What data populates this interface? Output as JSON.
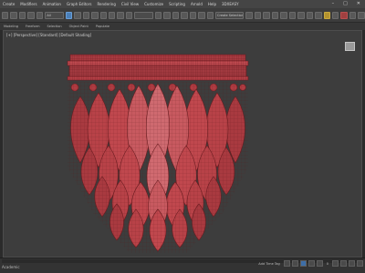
{
  "menu": {
    "items": [
      "Create",
      "Modifiers",
      "Animation",
      "Graph Editors",
      "Rendering",
      "Civil View",
      "Customize",
      "Scripting",
      "Arnold",
      "Help",
      "3DXEASY"
    ]
  },
  "window": {
    "minimize": "–",
    "maximize": "□",
    "close": "✕"
  },
  "toolbar": {
    "selection_filter": "All",
    "named_selection": "Create Selection Set"
  },
  "ribbon": {
    "items": [
      "Modeling",
      "Freeform",
      "Selection",
      "Object Paint",
      "Populate"
    ]
  },
  "viewport": {
    "label": "[+] [Perspective] [Standard] [Default Shading]"
  },
  "status": {
    "left": "Academic",
    "right": "Add Time Tag",
    "frame": "0"
  },
  "colors": {
    "model_fill": "#b84248",
    "model_light": "#d06a70",
    "model_dark": "#8a2a30",
    "wire": "#5a1418",
    "accent": "#4a7fb8"
  }
}
